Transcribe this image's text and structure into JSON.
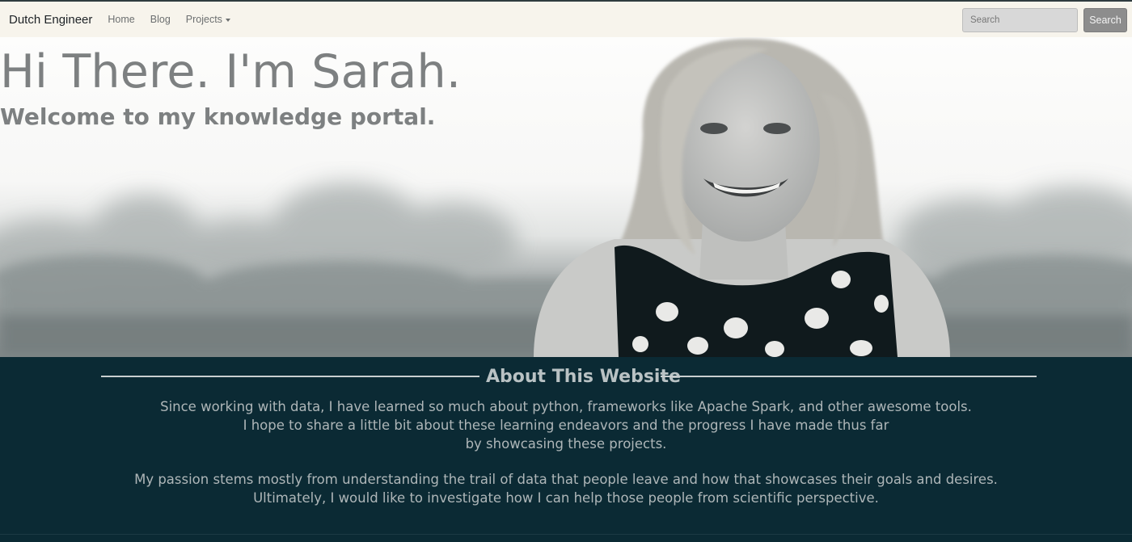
{
  "navbar": {
    "brand": "Dutch Engineer",
    "links": [
      {
        "label": "Home"
      },
      {
        "label": "Blog"
      },
      {
        "label": "Projects"
      }
    ],
    "search": {
      "placeholder": "Search",
      "button_label": "Search"
    }
  },
  "hero": {
    "title": "Hi There. I'm Sarah.",
    "subtitle": "Welcome to my knowledge portal."
  },
  "about": {
    "heading": "About This Website",
    "paragraph1": [
      "Since working with data, I have learned so much about python, frameworks like Apache Spark, and other awesome tools.",
      "I hope to share a little bit about these learning endeavors and the progress I have made thus far",
      "by showcasing these projects."
    ],
    "paragraph2": [
      "My passion stems mostly from understanding the trail of data that people leave and how that showcases their goals and desires.",
      "Ultimately, I would like to investigate how I can help those people from scientific perspective."
    ]
  },
  "colors": {
    "navbar_bg": "#f7f4ec",
    "about_bg": "#0b2a34",
    "hero_text": "#7d8081",
    "about_text": "#aeb6b8"
  }
}
